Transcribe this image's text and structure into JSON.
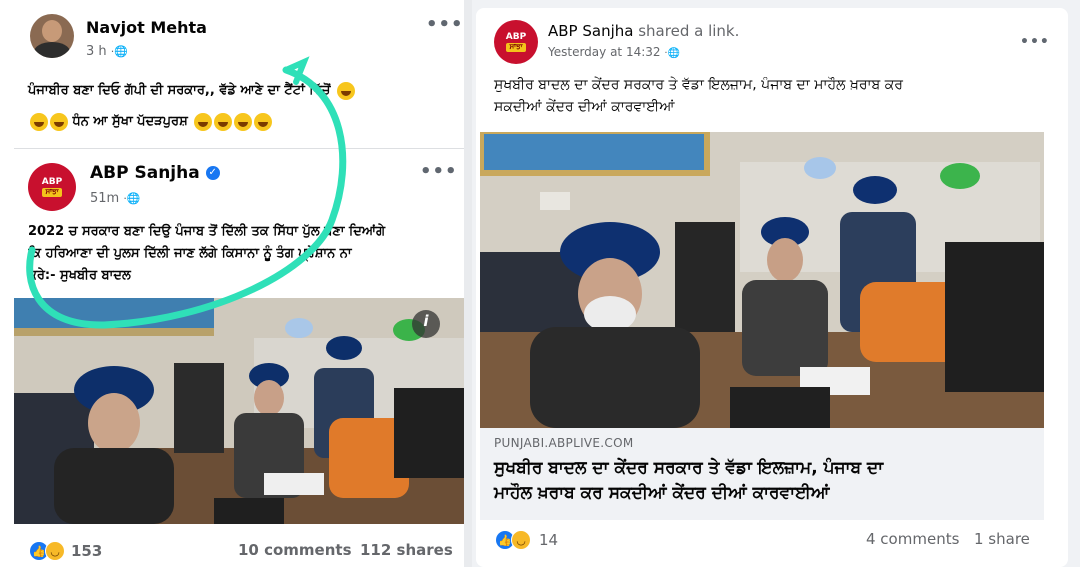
{
  "left_post": {
    "author": "Navjot Mehta",
    "time": "3 h",
    "text_line1": "ਪੰਜਾਬੀਰ ਬਣਾ ਦਿਓ ਗੱਪੀ ਦੀ ਸਰਕਾਰ,, ਵੱਡੇ ਆਣੇ ਦਾ ਟੈਂਟਾਂ ਵਿੱਚੋਂ",
    "text_line2": "ਧੰਨ ਆ ਸੁੱਖਾ ਪੱਦੜਪੁਰਸ਼",
    "shared": {
      "page_name": "ABP Sanjha",
      "verified_icon": "check-badge-icon",
      "time": "51m",
      "text_line1": "2022 ਚ ਸਰਕਾਰ ਬਣਾ ਦਿਉ ਪੰਜਾਬ ਤੋਂ ਦਿੱਲੀ ਤਕ ਸਿੱਧਾ ਪੁੱਲ ਬਣਾ ਦਿਆਂਗੇ",
      "text_line2": "ਕਿ ਹਰਿਆਣਾ ਦੀ ਪੁਲਸ ਦਿੱਲੀ ਜਾਣ ਲੱਗੇ ਕਿਸਾਨਾ ਨੂੰ ਤੰਗ ਪ੍ਰੇਸ਼ਾਨ ਨਾ",
      "text_line3": "ਕਰੇ:- ਸੁਖਬੀਰ ਬਾਦਲ"
    },
    "info_icon": "i",
    "reaction_count": "153",
    "comments": "10 comments",
    "shares": "112 shares"
  },
  "right_post": {
    "page_name": "ABP Sanjha",
    "shared_text": "shared a link.",
    "time": "Yesterday at 14:32",
    "text_line1": "ਸੁਖਬੀਰ ਬਾਦਲ ਦਾ ਕੇਂਦਰ ਸਰਕਾਰ ਤੇ ਵੱਡਾ ਇਲਜ਼ਾਮ, ਪੰਜਾਬ ਦਾ ਮਾਹੌਲ ਖ਼ਰਾਬ ਕਰ",
    "text_line2": "ਸਕਦੀਆਂ ਕੇਂਦਰ ਦੀਆਂ ਕਾਰਵਾਈਆਂ",
    "link_domain": "PUNJABI.ABPLIVE.COM",
    "link_title_line1": "ਸੁਖਬੀਰ ਬਾਦਲ ਦਾ ਕੇਂਦਰ ਸਰਕਾਰ ਤੇ ਵੱਡਾ ਇਲਜ਼ਾਮ, ਪੰਜਾਬ ਦਾ",
    "link_title_line2": "ਮਾਹੌਲ ਖ਼ਰਾਬ ਕਰ ਸਕਦੀਆਂ ਕੇਂਦਰ ਦੀਆਂ ਕਾਰਵਾਈਆਂ",
    "reaction_count": "14",
    "comments": "4 comments",
    "shares": "1 share"
  },
  "logo": {
    "line1": "ABP",
    "line2": "ਸਾਂਝਾ"
  },
  "annotation_color": "#2fe0b8",
  "brand_red": "#c8102e"
}
